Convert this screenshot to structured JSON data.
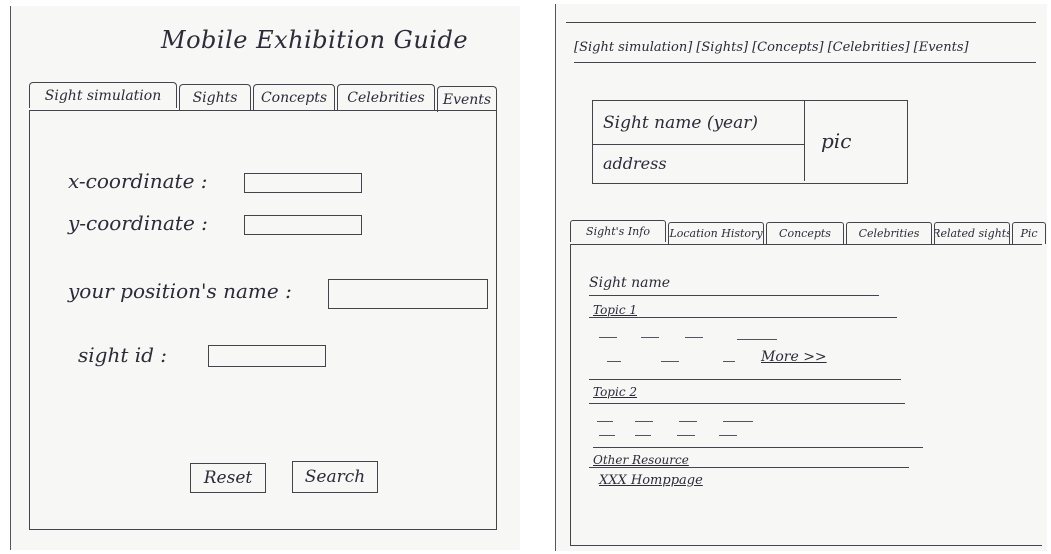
{
  "left": {
    "title": "Mobile Exhibition Guide",
    "tabs": [
      "Sight simulation",
      "Sights",
      "Concepts",
      "Celebrities",
      "Events"
    ],
    "fields": {
      "x_label": "x-coordinate :",
      "y_label": "y-coordinate :",
      "position_label": "your position's name :",
      "sight_id_label": "sight id :"
    },
    "buttons": {
      "reset": "Reset",
      "search": "Search"
    }
  },
  "right": {
    "nav": [
      "[Sight simulation]",
      "[Sights]",
      "[Concepts]",
      "[Celebrities]",
      "[Events]"
    ],
    "header": {
      "sight_name": "Sight name (year)",
      "address": "address",
      "pic": "pic"
    },
    "tabs": [
      "Sight's Info",
      "Location History",
      "Concepts",
      "Celebrities",
      "Related sights",
      "Pic"
    ],
    "content": {
      "sight_name": "Sight name",
      "topic1": "Topic 1",
      "more": "More >>",
      "topic2": "Topic 2",
      "other_resource": "Other Resource",
      "homepage": "XXX Homppage"
    }
  }
}
